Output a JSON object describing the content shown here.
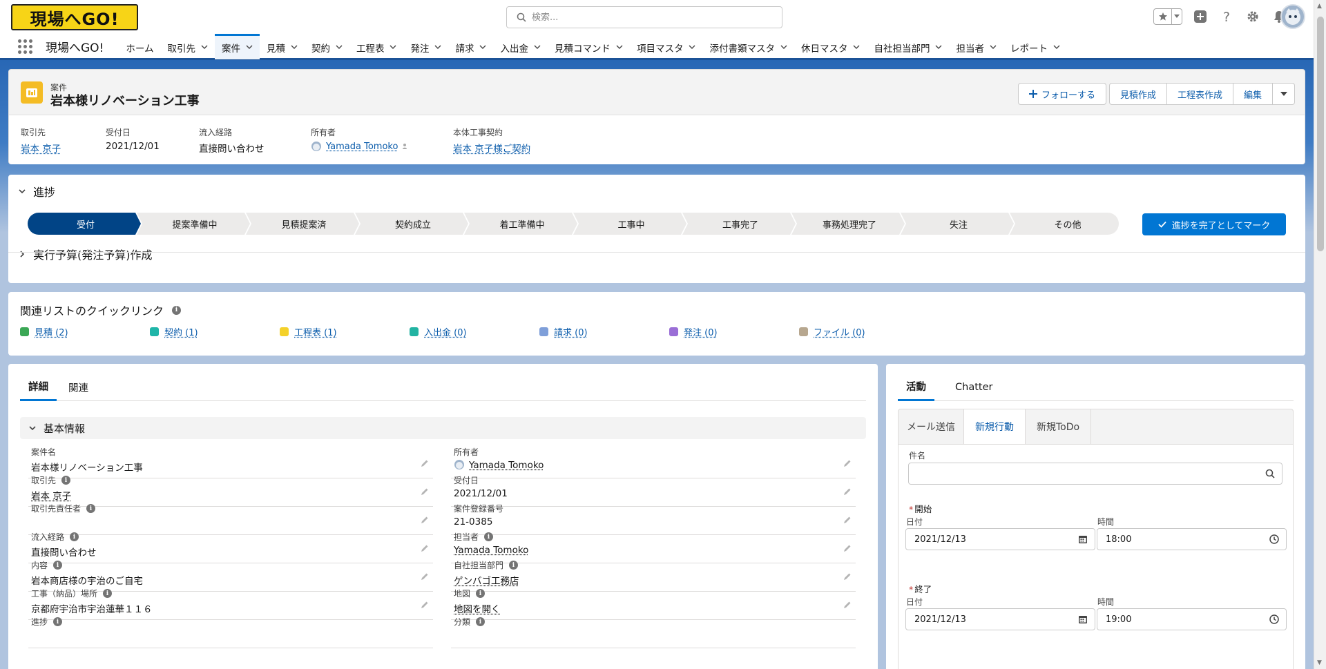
{
  "app": {
    "logo_text": "現場へGO!",
    "app_name": "現場へGO!",
    "search_placeholder": "検索..."
  },
  "nav": {
    "items": [
      {
        "label": "ホーム",
        "has_menu": false,
        "active": false
      },
      {
        "label": "取引先",
        "has_menu": true,
        "active": false
      },
      {
        "label": "案件",
        "has_menu": true,
        "active": true
      },
      {
        "label": "見積",
        "has_menu": true,
        "active": false
      },
      {
        "label": "契約",
        "has_menu": true,
        "active": false
      },
      {
        "label": "工程表",
        "has_menu": true,
        "active": false
      },
      {
        "label": "発注",
        "has_menu": true,
        "active": false
      },
      {
        "label": "請求",
        "has_menu": true,
        "active": false
      },
      {
        "label": "入出金",
        "has_menu": true,
        "active": false
      },
      {
        "label": "見積コマンド",
        "has_menu": true,
        "active": false
      },
      {
        "label": "項目マスタ",
        "has_menu": true,
        "active": false
      },
      {
        "label": "添付書類マスタ",
        "has_menu": true,
        "active": false
      },
      {
        "label": "休日マスタ",
        "has_menu": true,
        "active": false
      },
      {
        "label": "自社担当部門",
        "has_menu": true,
        "active": false
      },
      {
        "label": "担当者",
        "has_menu": true,
        "active": false
      },
      {
        "label": "レポート",
        "has_menu": true,
        "active": false
      }
    ]
  },
  "record": {
    "type_label": "案件",
    "title": "岩本様リノベーション工事",
    "actions": {
      "follow": "フォローする",
      "estimate": "見積作成",
      "schedule": "工程表作成",
      "edit": "編集"
    },
    "highlights": [
      {
        "label": "取引先",
        "value": "岩本 京子",
        "link": true
      },
      {
        "label": "受付日",
        "value": "2021/12/01",
        "link": false
      },
      {
        "label": "流入経路",
        "value": "直接問い合わせ",
        "link": false
      },
      {
        "label": "所有者",
        "value": "Yamada Tomoko",
        "link": true
      },
      {
        "label": "本体工事契約",
        "value": "岩本 京子様ご契約",
        "link": true
      }
    ]
  },
  "path": {
    "section_label": "進捗",
    "stages": [
      "受付",
      "提案準備中",
      "見積提案済",
      "契約成立",
      "着工準備中",
      "工事中",
      "工事完了",
      "事務処理完了",
      "失注",
      "その他"
    ],
    "current_index": 0,
    "mark_button": "進捗を完了としてマーク",
    "budget_section": "実行予算(発注予算)作成"
  },
  "quick_links": {
    "title": "関連リストのクイックリンク",
    "links": [
      {
        "label": "見積 (2)",
        "color": "#3ba755"
      },
      {
        "label": "契約 (1)",
        "color": "#1fb5a8"
      },
      {
        "label": "工程表 (1)",
        "color": "#f4d12a"
      },
      {
        "label": "入出金 (0)",
        "color": "#22b3a2"
      },
      {
        "label": "請求 (0)",
        "color": "#7f9fd9"
      },
      {
        "label": "発注 (0)",
        "color": "#9a6ed6"
      },
      {
        "label": "ファイル (0)",
        "color": "#b7a78f"
      }
    ]
  },
  "details": {
    "tabs": [
      "詳細",
      "関連"
    ],
    "section_title": "基本情報",
    "left_fields": [
      {
        "label": "案件名",
        "value": "岩本様リノベーション工事",
        "info": false,
        "link": false
      },
      {
        "label": "取引先",
        "value": "岩本 京子",
        "info": true,
        "link": true
      },
      {
        "label": "取引先責任者",
        "value": "",
        "info": true,
        "link": false
      },
      {
        "label": "流入経路",
        "value": "直接問い合わせ",
        "info": true,
        "link": false
      },
      {
        "label": "内容",
        "value": "岩本商店様の宇治のご自宅",
        "info": true,
        "link": false
      },
      {
        "label": "工事（納品）場所",
        "value": "京都府宇治市宇治蓮華１１６",
        "info": true,
        "link": false
      },
      {
        "label": "進捗",
        "value": "",
        "info": true,
        "link": false
      }
    ],
    "right_fields": [
      {
        "label": "所有者",
        "value": "Yamada Tomoko",
        "info": false,
        "link": true
      },
      {
        "label": "受付日",
        "value": "2021/12/01",
        "info": false,
        "link": false
      },
      {
        "label": "案件登録番号",
        "value": "21-0385",
        "info": false,
        "link": false
      },
      {
        "label": "担当者",
        "value": "Yamada Tomoko",
        "info": true,
        "link": true
      },
      {
        "label": "自社担当部門",
        "value": "ゲンバゴ工務店",
        "info": true,
        "link": true
      },
      {
        "label": "地図",
        "value": "地図を開く",
        "info": true,
        "link": true
      },
      {
        "label": "分類",
        "value": "",
        "info": true,
        "link": false
      }
    ]
  },
  "activity": {
    "tabs": [
      "活動",
      "Chatter"
    ],
    "subtabs": [
      "メール送信",
      "新規行動",
      "新規ToDo"
    ],
    "subject_label": "件名",
    "subject_value": "",
    "start_label": "開始",
    "end_label": "終了",
    "date_label": "日付",
    "time_label": "時間",
    "start_date": "2021/12/13",
    "start_time": "18:00",
    "end_date": "2021/12/13",
    "end_time": "19:00"
  }
}
